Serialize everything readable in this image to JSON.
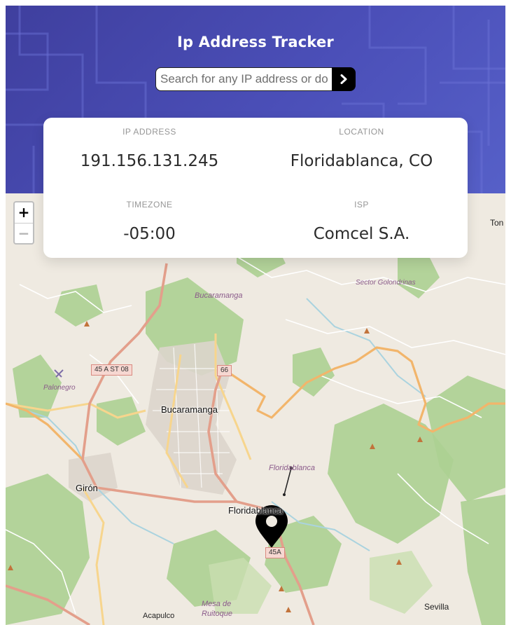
{
  "header": {
    "title": "Ip Address Tracker",
    "search_placeholder": "Search for any IP address or domain",
    "submit_icon": "chevron-right-icon"
  },
  "info": {
    "ip_label": "IP ADDRESS",
    "ip_value": "191.156.131.245",
    "location_label": "LOCATION",
    "location_value": "Floridablanca, CO",
    "timezone_label": "TIMEZONE",
    "timezone_value": "-05:00",
    "isp_label": "ISP",
    "isp_value": "Comcel S.A."
  },
  "map": {
    "zoom_in": "+",
    "zoom_out": "−",
    "marker_icon": "location-pin-icon",
    "labels": {
      "bucaramanga_italic": "Bucaramanga",
      "sector": "Sector Golondrinas",
      "palonegro": "Palonegro",
      "bucaramanga": "Bucaramanga",
      "giron": "Girón",
      "floridablanca_italic": "Floridablanca",
      "floridablanca": "Floridablanca",
      "mesa": "Mesa de",
      "ruitoque": "Ruitoque",
      "acapulco": "Acapulco",
      "sevilla": "Sevilla",
      "tona": "Ton"
    },
    "shields": {
      "a": "45 A ST 08",
      "b": "66",
      "c": "45A"
    }
  },
  "colors": {
    "header_start": "#3f3f9e",
    "header_end": "#5660c8",
    "map_land": "#efeae1",
    "forest": "#a9cf8f",
    "main_road": "#e8a28f",
    "secondary_road": "#f5c77e"
  }
}
